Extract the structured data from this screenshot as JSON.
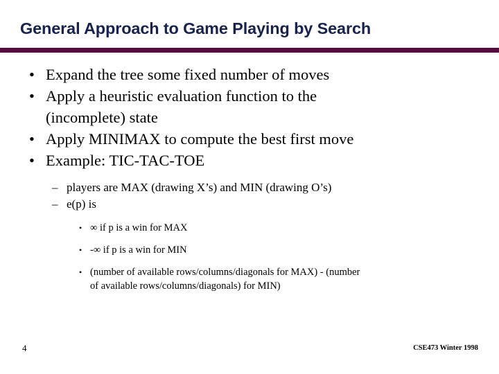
{
  "slide": {
    "title": "General Approach to Game Playing by Search",
    "title_color": "#17234f",
    "rule_color": "#570a3e",
    "background_color": "#ffffff",
    "text_color": "#000000"
  },
  "bullets": {
    "level1_marker": "•",
    "level2_marker": "–",
    "level3_marker": "•",
    "items": [
      {
        "text": "Expand the tree some fixed number of moves"
      },
      {
        "text": "Apply a heuristic evaluation function to the",
        "text_line2": "(incomplete) state"
      },
      {
        "text": "Apply MINIMAX to compute the best first move"
      },
      {
        "text": "Example:  TIC-TAC-TOE"
      }
    ],
    "sub_items": [
      {
        "text": "players are MAX (drawing X’s) and MIN (drawing O’s)"
      },
      {
        "text": "e(p)  is"
      }
    ],
    "sub_sub_items": [
      {
        "text": "∞ if p is a win for MAX"
      },
      {
        "text": "-∞ if p is a win for MIN"
      },
      {
        "text": "(number of available rows/columns/diagonals for MAX) - (number",
        "text_line2": "of available rows/columns/diagonals) for MIN)"
      }
    ]
  },
  "footer": {
    "slide_number": "4",
    "note": "CSE473 Winter 1998"
  }
}
